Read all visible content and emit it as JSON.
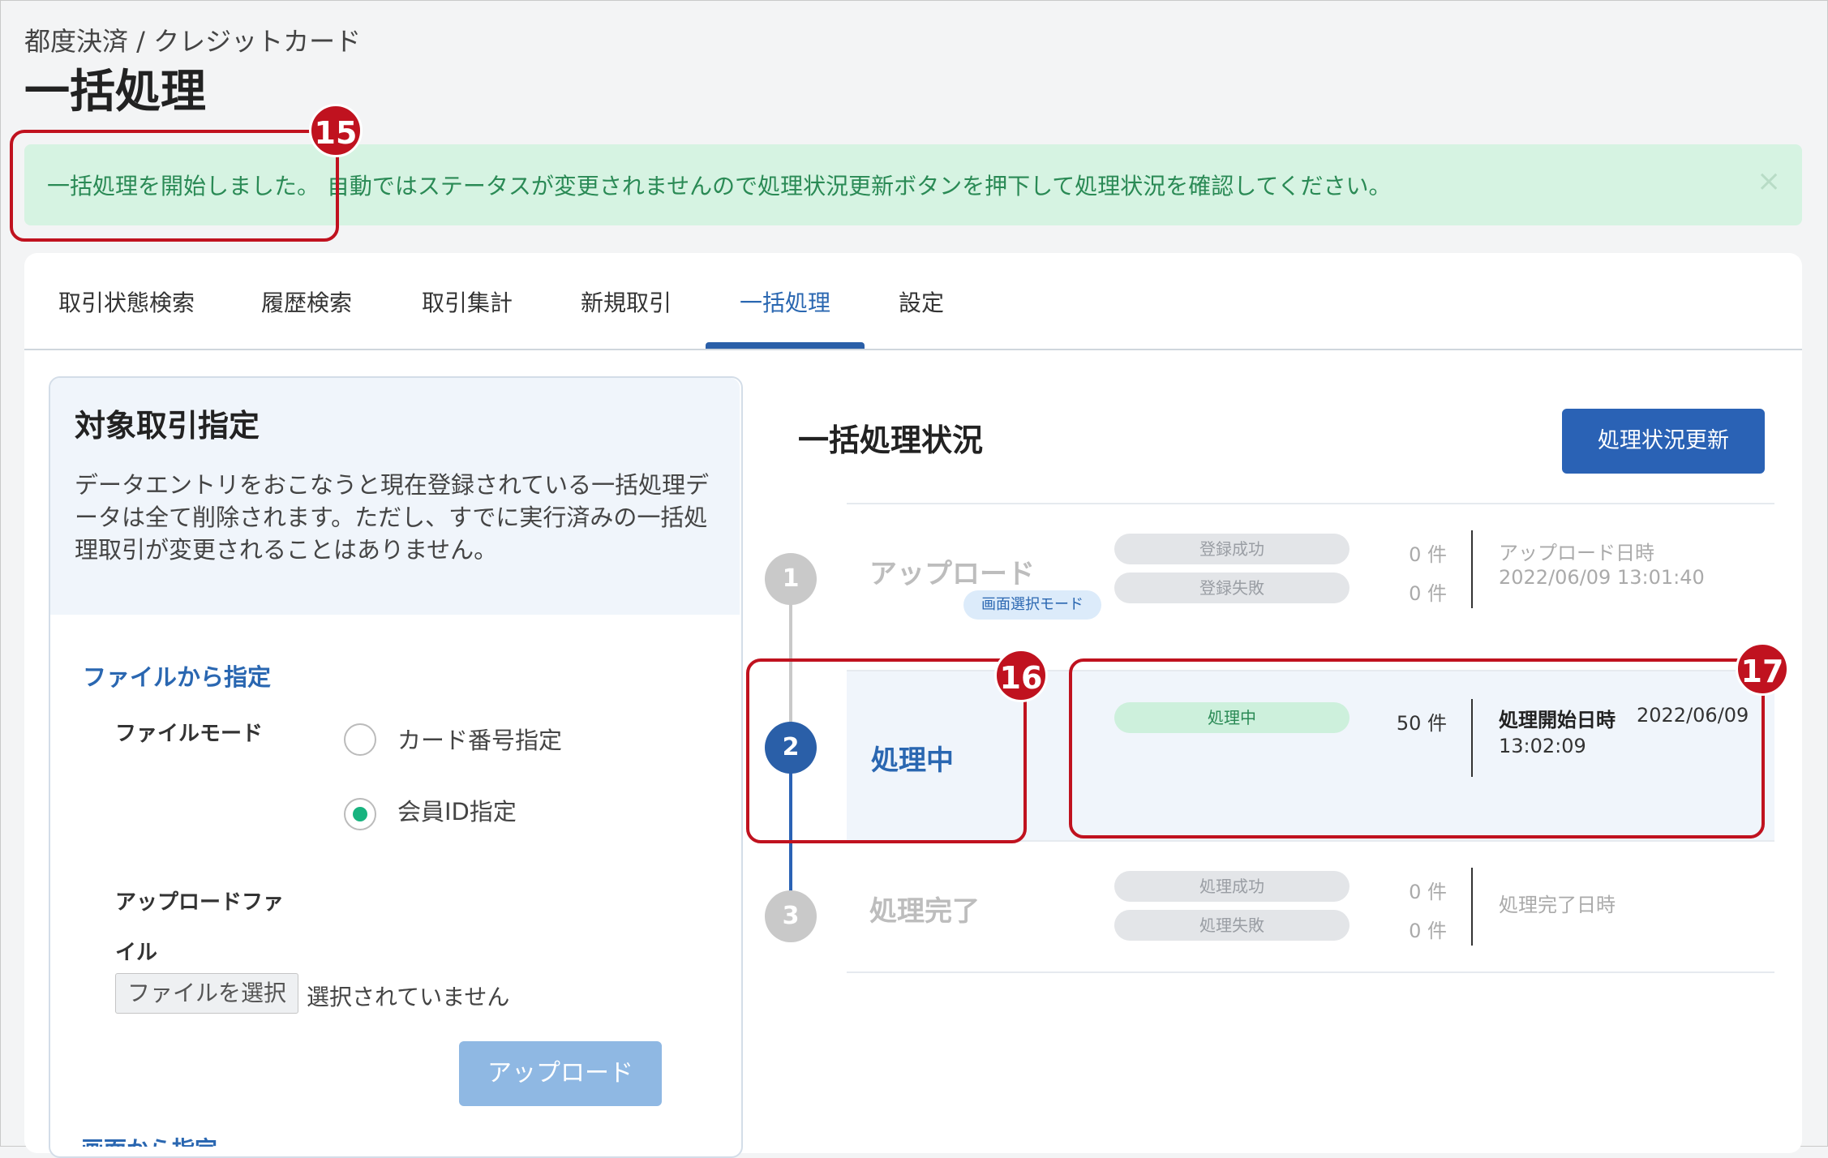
{
  "breadcrumb": "都度決済 / クレジットカード",
  "page_title": "一括処理",
  "alert": {
    "message": "一括処理を開始しました。 自動ではステータスが変更されませんので処理状況更新ボタンを押下して処理状況を確認してください。",
    "close_icon": "×"
  },
  "tabs": [
    {
      "label": "取引状態検索"
    },
    {
      "label": "履歴検索"
    },
    {
      "label": "取引集計"
    },
    {
      "label": "新規取引"
    },
    {
      "label": "一括処理"
    },
    {
      "label": "設定"
    }
  ],
  "active_tab": "一括処理",
  "left": {
    "title": "対象取引指定",
    "notice": "データエントリをおこなうと現在登録されている一括処理データは全て削除されます。ただし、すでに実行済みの一括処理取引が変更されることはありません。",
    "file_section": "ファイルから指定",
    "file_mode_label": "ファイルモード",
    "radio_card": "カード番号指定",
    "radio_member": "会員ID指定",
    "upload_file_label_1": "アップロードファ",
    "upload_file_label_2": "イル",
    "choose_file": "ファイルを選択",
    "no_file": "選択されていません",
    "upload_button": "アップロード",
    "screen_section": "画面から指定"
  },
  "right": {
    "title": "一括処理状況",
    "refresh_button": "処理状況更新",
    "steps": [
      {
        "num": "1",
        "label": "アップロード",
        "mode_tag": "画面選択モード",
        "pill1": "登録成功",
        "count1": "0 件",
        "pill2": "登録失敗",
        "count2": "0 件",
        "time_label": "アップロード日時",
        "time_value": "2022/06/09 13:01:40"
      },
      {
        "num": "2",
        "label": "処理中",
        "pill1": "処理中",
        "count1": "50 件",
        "time_label": "処理開始日時",
        "time_value_1": "2022/06/09",
        "time_value_2": "13:02:09"
      },
      {
        "num": "3",
        "label": "処理完了",
        "pill1": "処理成功",
        "count1": "0 件",
        "pill2": "処理失敗",
        "count2": "0 件",
        "time_label": "処理完了日時"
      }
    ]
  },
  "annotations": [
    "15",
    "16",
    "17"
  ],
  "colors": {
    "accent": "#2a62b5",
    "success_bg": "#d6f3e2",
    "annotation": "#c0121f",
    "radio_checked": "#17b37f"
  }
}
